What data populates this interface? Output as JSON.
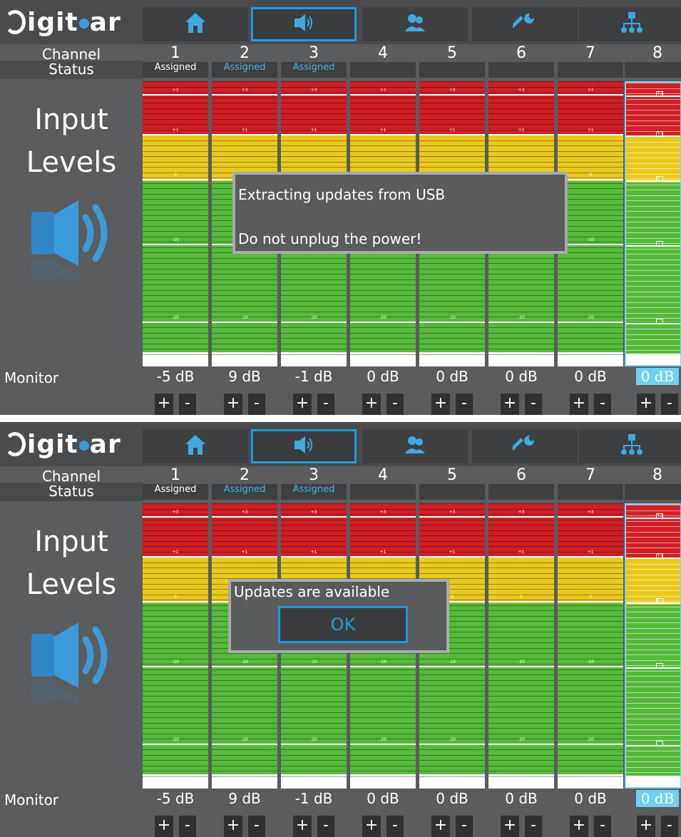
{
  "brand": {
    "logo_text": "igit",
    "logo_text2": "ar"
  },
  "nav": [
    {
      "name": "home-icon"
    },
    {
      "name": "speaker-icon",
      "active": true
    },
    {
      "name": "users-icon"
    },
    {
      "name": "wrench-icon"
    },
    {
      "name": "network-icon"
    }
  ],
  "labels": {
    "channel": "Channel",
    "status": "Status",
    "input_levels_1": "Input",
    "input_levels_2": "Levels",
    "monitor": "Monitor"
  },
  "channels": [
    {
      "num": "1",
      "status": "Assigned",
      "status_color": "white",
      "monitor": "-5 dB"
    },
    {
      "num": "2",
      "status": "Assigned",
      "status_color": "blue",
      "monitor": "9 dB"
    },
    {
      "num": "3",
      "status": "Assigned",
      "status_color": "blue",
      "monitor": "-1 dB"
    },
    {
      "num": "4",
      "status": "",
      "monitor": "0 dB"
    },
    {
      "num": "5",
      "status": "",
      "monitor": "0 dB"
    },
    {
      "num": "6",
      "status": "",
      "monitor": "0 dB"
    },
    {
      "num": "7",
      "status": "",
      "monitor": "0 dB"
    },
    {
      "num": "8",
      "status": "",
      "monitor": "0 dB",
      "selected": true
    }
  ],
  "meter_marks": [
    "+3",
    "+1",
    "0",
    "-10",
    "-20"
  ],
  "buttons": {
    "plus": "+",
    "minus": "-"
  },
  "dialog_a": {
    "line1": "Extracting updates from USB",
    "line2": "Do not unplug the power!"
  },
  "dialog_b": {
    "message": "Updates are available",
    "ok_label": "OK"
  },
  "colors": {
    "accent": "#1e9bd7",
    "red": "#d01f26",
    "yellow": "#e8c91d",
    "green": "#55ba3a",
    "panel": "#5b5c5e"
  }
}
